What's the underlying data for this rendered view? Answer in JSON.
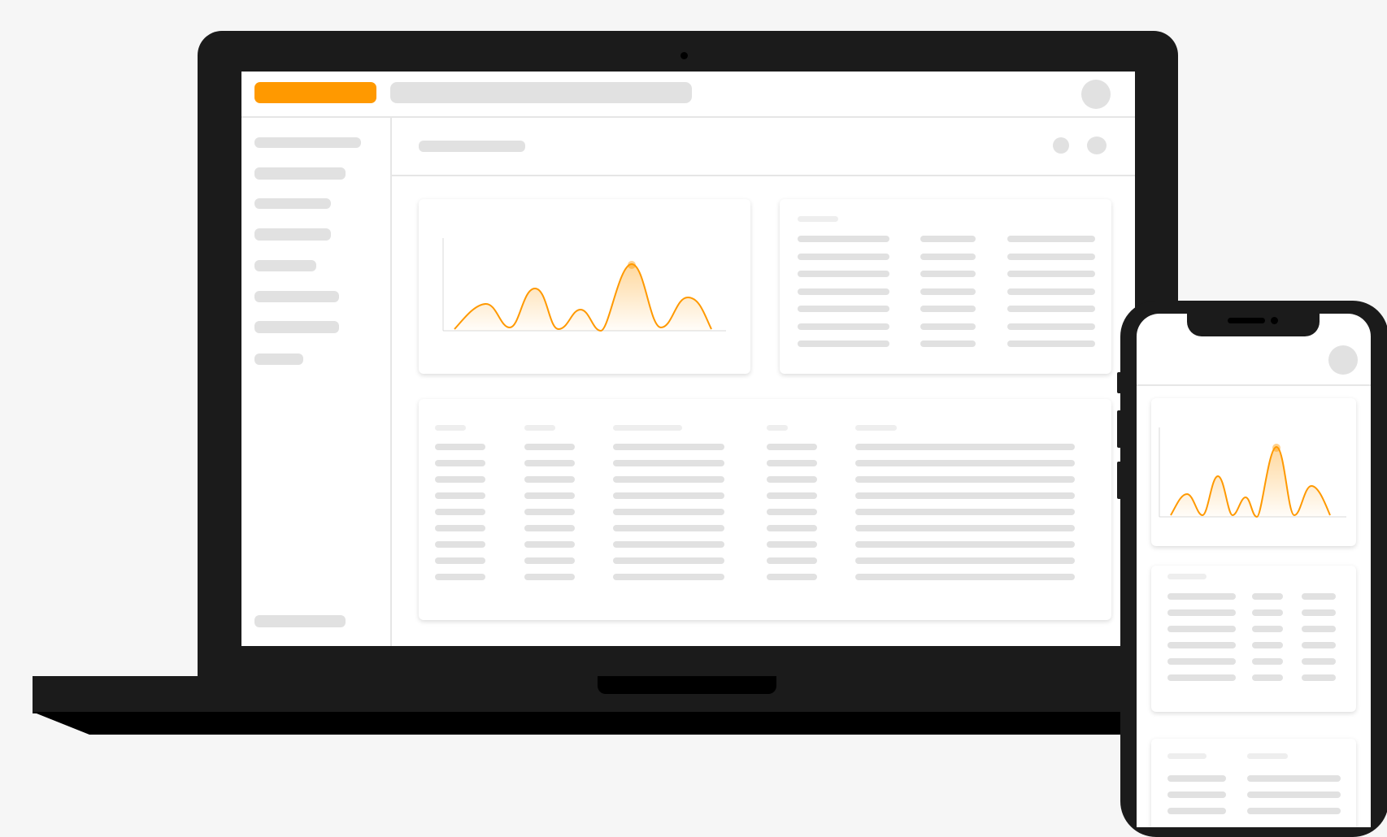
{
  "colors": {
    "accent": "#ff9900",
    "device_frame": "#1b1b1b",
    "placeholder": "#e1e1e1",
    "placeholder_light": "#eeeeee",
    "background": "#f6f6f6"
  },
  "devices": {
    "laptop": {
      "topbar": {
        "logo_color": "#ff9900"
      },
      "sidebar": {
        "item_count": 8
      },
      "widgets": {
        "chart_card": {
          "chart": "line-area",
          "line_color": "#ff9900",
          "peak_marker": "highlighted-peak"
        },
        "summary_table": {
          "columns": 3,
          "rows": 7
        },
        "main_table": {
          "columns": 5,
          "rows": 9
        }
      }
    },
    "phone": {
      "widgets": {
        "chart_card": {
          "chart": "line-area",
          "line_color": "#ff9900"
        },
        "table_card": {
          "columns": 3,
          "rows": 6
        },
        "list_card": {
          "columns": 2,
          "rows": 3
        }
      }
    }
  },
  "icons": [
    "avatar-icon",
    "action-dot-icon",
    "camera-icon"
  ]
}
